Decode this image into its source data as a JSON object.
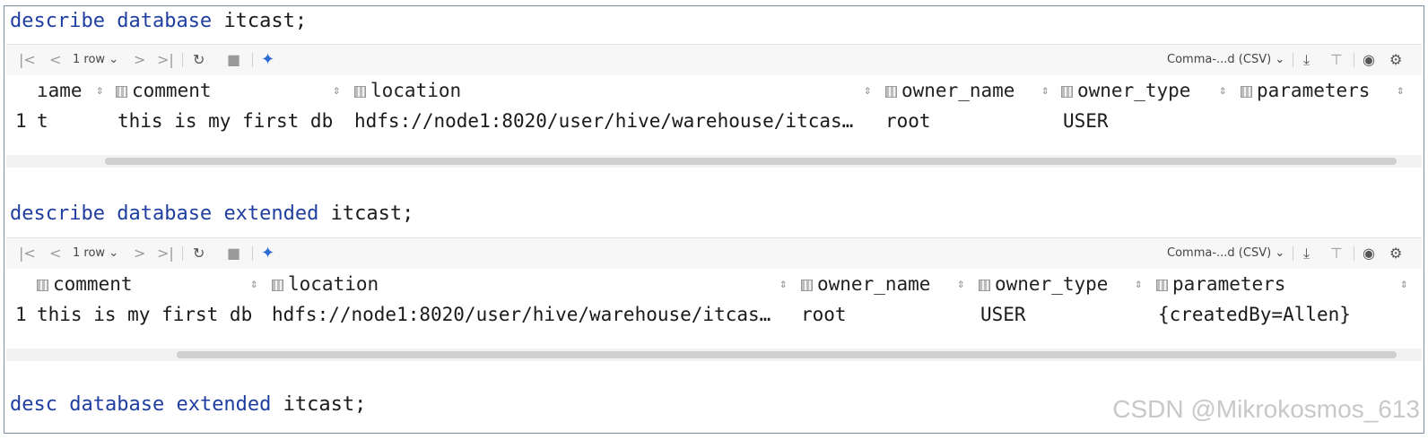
{
  "queries": [
    {
      "kw": [
        "describe",
        "database"
      ],
      "rest": "itcast;"
    },
    {
      "kw": [
        "describe",
        "database",
        "extended"
      ],
      "rest": "itcast;"
    },
    {
      "kw": [
        "desc",
        "database",
        "extended"
      ],
      "rest": "itcast;"
    }
  ],
  "toolbar": {
    "first": "|<",
    "prev": "<",
    "row_count": "1 row",
    "next": ">",
    "last": ">|",
    "refresh": "↻",
    "stop": "■",
    "export_format": "Comma-...d (CSV)",
    "dropdown": "⌄",
    "download": "⤓",
    "filter": "⊤",
    "view": "◉",
    "settings": "⚙"
  },
  "result1": {
    "columns": [
      "ıame",
      "comment",
      "location",
      "owner_name",
      "owner_type",
      "parameters"
    ],
    "row_index": "1",
    "cells": [
      "t",
      "this is my first db",
      "hdfs://node1:8020/user/hive/warehouse/itcas…",
      "root",
      "USER",
      ""
    ]
  },
  "result2": {
    "columns": [
      "comment",
      "location",
      "owner_name",
      "owner_type",
      "parameters"
    ],
    "row_index": "1",
    "cells": [
      "this is my first db",
      "hdfs://node1:8020/user/hive/warehouse/itcas…",
      "root",
      "USER",
      "{createdBy=Allen}"
    ]
  },
  "watermark": "CSDN @Mikrokosmos_613"
}
